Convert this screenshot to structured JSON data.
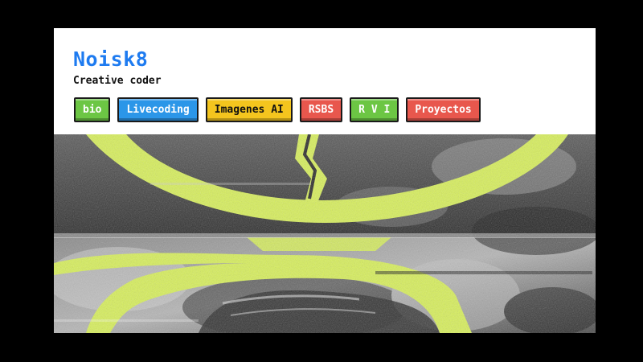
{
  "site": {
    "title": "Noisk8",
    "tagline": "Creative coder"
  },
  "nav": {
    "items": [
      {
        "label": "bio",
        "bg": "#6cc644",
        "fg": "#ffffff"
      },
      {
        "label": "Livecoding",
        "bg": "#2b96e8",
        "fg": "#ffffff"
      },
      {
        "label": "Imagenes AI",
        "bg": "#f4c51e",
        "fg": "#111111"
      },
      {
        "label": "RSBS",
        "bg": "#e8574d",
        "fg": "#ffffff"
      },
      {
        "label": "R V I",
        "bg": "#6cc644",
        "fg": "#ffffff"
      },
      {
        "label": "Proyectos",
        "bg": "#e8574d",
        "fg": "#ffffff"
      }
    ]
  },
  "theme": {
    "title_color": "#1e7bf0",
    "page_bg": "#000000",
    "accent_yellow": "#d7ef5a"
  },
  "hero": {
    "description": ""
  }
}
